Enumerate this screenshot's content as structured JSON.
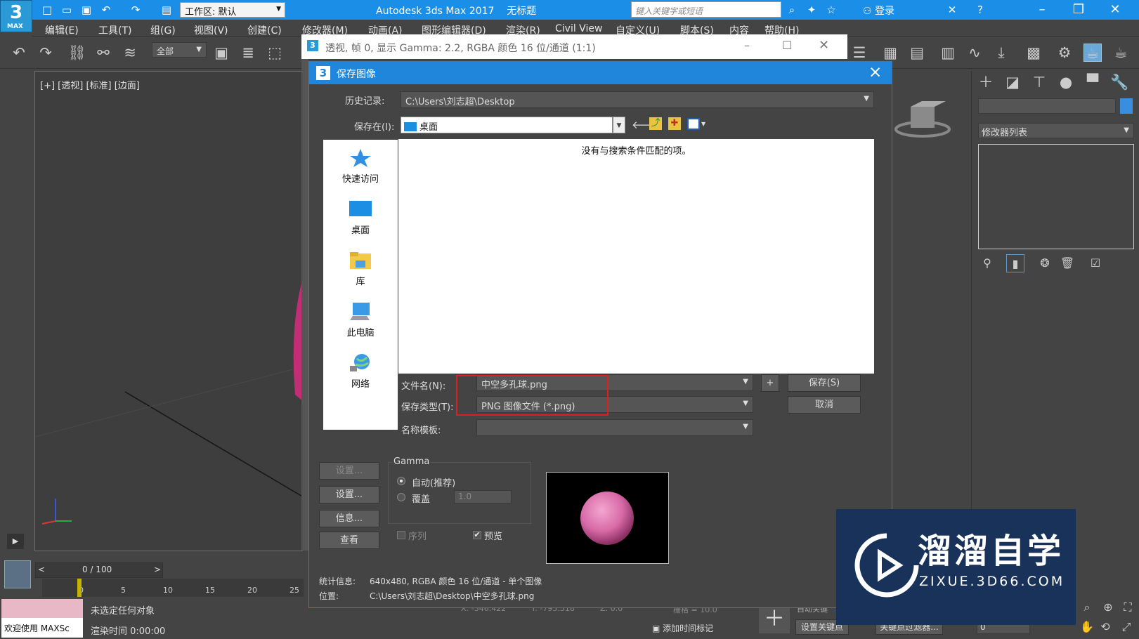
{
  "app": {
    "title": "Autodesk 3ds Max 2017",
    "doc": "无标题",
    "logo": "3",
    "logo_sub": "MAX",
    "workspace": "工作区: 默认",
    "search_placeholder": "键入关键字或短语",
    "login": "登录"
  },
  "menus": [
    "编辑(E)",
    "工具(T)",
    "组(G)",
    "视图(V)",
    "创建(C)",
    "修改器(M)",
    "动画(A)",
    "图形编辑器(D)",
    "渲染(R)",
    "Civil View",
    "自定义(U)",
    "脚本(S)",
    "内容",
    "帮助(H)"
  ],
  "toolbar": {
    "filter": "全部"
  },
  "viewport": {
    "label": "[+] [透视] [标准] [边面]",
    "play": "▶"
  },
  "image_window": {
    "title": "透视, 帧 0, 显示 Gamma: 2.2, RGBA 颜色 16 位/通道 (1:1)"
  },
  "dialog": {
    "title": "保存图像",
    "icon": "3",
    "history_label": "历史记录:",
    "history_value": "C:\\Users\\刘志超\\Desktop",
    "savein_label": "保存在(I):",
    "savein_value": "桌面",
    "places": [
      "快速访问",
      "桌面",
      "库",
      "此电脑",
      "网络"
    ],
    "empty_message": "没有与搜索条件匹配的项。",
    "filename_label": "文件名(N):",
    "filename_value": "中空多孔球.png",
    "filetype_label": "保存类型(T):",
    "filetype_value": "PNG 图像文件 (*.png)",
    "template_label": "名称模板:",
    "template_value": "",
    "plus": "+",
    "save_button": "保存(S)",
    "cancel_button": "取消",
    "setup_button_disabled": "设置...",
    "setup_button": "设置...",
    "info_button": "信息...",
    "view_button": "查看",
    "gamma_title": "Gamma",
    "gamma_auto": "自动(推荐)",
    "gamma_override": "覆盖",
    "gamma_value": "1.0",
    "sequence": "序列",
    "preview": "预览",
    "stats_label": "统计信息:",
    "stats_value": "640x480, RGBA 颜色 16 位/通道 - 单个图像",
    "location_label": "位置:",
    "location_value": "C:\\Users\\刘志超\\Desktop\\中空多孔球.png"
  },
  "right_panel": {
    "modifier_list": "修改器列表"
  },
  "status": {
    "frame": "0 / 100",
    "ticks": [
      "0",
      "5",
      "10",
      "15",
      "20",
      "25"
    ],
    "no_selection": "未选定任何对象",
    "render_time": "渲染时间  0:00:00",
    "welcome": "欢迎使用 MAXSc",
    "x_label": "X:",
    "x_value": "-346.422",
    "y_label": "Y:",
    "y_value": "-795.518",
    "z_label": "Z:",
    "z_value": "0.0",
    "grid": "栅格 = 10.0",
    "auto_key": "自动关键",
    "set_key": "设置关键点",
    "add_time_tag": "添加时间标记",
    "key_filters": "关键点过滤器...",
    "frame_spinner": "0"
  },
  "watermark": {
    "brand": "溜溜自学",
    "url": "ZIXUE.3D66.COM"
  },
  "colors": {
    "accent": "#1b8ee8",
    "dialog_header": "#1f86dc",
    "highlight": "#e11d1d",
    "sphere": "#d86aa8"
  }
}
